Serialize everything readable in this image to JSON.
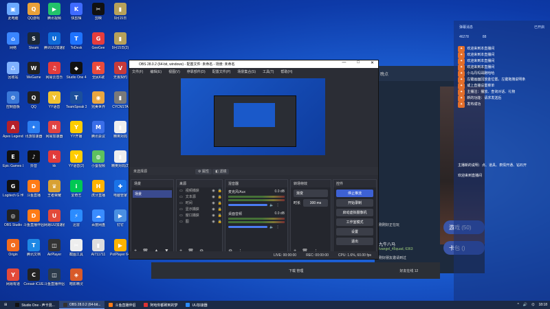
{
  "desktop_icons": [
    {
      "label": "此电脑",
      "color": "#6aa9ff",
      "glyph": "▣"
    },
    {
      "label": "QQ游戏",
      "color": "#e8a13a",
      "glyph": "Q"
    },
    {
      "label": "腾讯视频",
      "color": "#23c26b",
      "glyph": "▶"
    },
    {
      "label": "快剪辑",
      "color": "#3f6bff",
      "glyph": "K"
    },
    {
      "label": "剪映",
      "color": "#111111",
      "glyph": "✂"
    },
    {
      "label": "9月15日",
      "color": "#b7a15a",
      "glyph": "▮"
    },
    {
      "label": "网络",
      "color": "#3a86ff",
      "glyph": "⌂"
    },
    {
      "label": "Steam",
      "color": "#1b2838",
      "glyph": "S"
    },
    {
      "label": "腾讯UU加速器",
      "color": "#0f6bd9",
      "glyph": "U"
    },
    {
      "label": "ToDesk",
      "color": "#1e73ff",
      "glyph": "T"
    },
    {
      "label": "GeeGee",
      "color": "#e53d3d",
      "glyph": "G"
    },
    {
      "label": "9月15日(2)",
      "color": "#b7a15a",
      "glyph": "▮"
    },
    {
      "label": "回收站",
      "color": "#7fb1ff",
      "glyph": "♺"
    },
    {
      "label": "WeGame",
      "color": "#222222",
      "glyph": "W"
    },
    {
      "label": "网易云音乐",
      "color": "#e33c3c",
      "glyph": "♫"
    },
    {
      "label": "Studio One 4",
      "color": "#111111",
      "glyph": "◆"
    },
    {
      "label": "全民K歌",
      "color": "#e94b3c",
      "glyph": "K"
    },
    {
      "label": "无畏契约",
      "color": "#c63b3b",
      "glyph": "V"
    },
    {
      "label": "控制面板",
      "color": "#3a78d8",
      "glyph": "⚙"
    },
    {
      "label": "QQ",
      "color": "#222222",
      "glyph": "Q"
    },
    {
      "label": "YY语音",
      "color": "#f1c232",
      "glyph": "Y"
    },
    {
      "label": "TeamSpeak 3",
      "color": "#1c4f9c",
      "glyph": "T"
    },
    {
      "label": "完美世界",
      "color": "#e9a640",
      "glyph": "◉"
    },
    {
      "label": "CYCNSTA",
      "color": "#7a7a7a",
      "glyph": "▮"
    },
    {
      "label": "Apex Legends",
      "color": "#b4202a",
      "glyph": "A"
    },
    {
      "label": "讯游加速器",
      "color": "#2a7df1",
      "glyph": "✦"
    },
    {
      "label": "网易加速器",
      "color": "#e04343",
      "glyph": "N"
    },
    {
      "label": "YY开播",
      "color": "#ffcc00",
      "glyph": "Y"
    },
    {
      "label": "腾讯会议",
      "color": "#3a6ee8",
      "glyph": "M"
    },
    {
      "label": "精英对局",
      "color": "#eeeeee",
      "glyph": "▮"
    },
    {
      "label": "Epic Games Launcher",
      "color": "#111111",
      "glyph": "E"
    },
    {
      "label": "抖音",
      "color": "#111111",
      "glyph": "♪"
    },
    {
      "label": "kk",
      "color": "#e13b3b",
      "glyph": "k"
    },
    {
      "label": "YY语音(2)",
      "color": "#ffcc00",
      "glyph": "Y"
    },
    {
      "label": "小蚕视频",
      "color": "#5ec15e",
      "glyph": "◍"
    },
    {
      "label": "精英对局(2)",
      "color": "#eeeeee",
      "glyph": "▮"
    },
    {
      "label": "Logitech G HUB",
      "color": "#111111",
      "glyph": "G"
    },
    {
      "label": "斗鱼直播",
      "color": "#ff7b16",
      "glyph": "D"
    },
    {
      "label": "王者荣耀",
      "color": "#d8a133",
      "glyph": "♛"
    },
    {
      "label": "爱奇艺",
      "color": "#00c853",
      "glyph": "i"
    },
    {
      "label": "虎牙直播",
      "color": "#ffb300",
      "glyph": "H"
    },
    {
      "label": "电脑管家",
      "color": "#1a73e8",
      "glyph": "✚"
    },
    {
      "label": "OBS Studio",
      "color": "#222222",
      "glyph": "◎"
    },
    {
      "label": "斗鱼直播伴侣",
      "color": "#ff7b16",
      "glyph": "D"
    },
    {
      "label": "网易UU加速器",
      "color": "#e24a3a",
      "glyph": "U"
    },
    {
      "label": "迅雷",
      "color": "#2b8cff",
      "glyph": "⚡"
    },
    {
      "label": "百度网盘",
      "color": "#3a8cff",
      "glyph": "☁"
    },
    {
      "label": "钉钉",
      "color": "#4a90e2",
      "glyph": "▶"
    },
    {
      "label": "Origin",
      "color": "#f26b1d",
      "glyph": "O"
    },
    {
      "label": "腾讯文档",
      "color": "#1e88e5",
      "glyph": "T"
    },
    {
      "label": "AirPlayer",
      "color": "#333333",
      "glyph": "◫"
    },
    {
      "label": "截图工具",
      "color": "#eeeeee",
      "glyph": "✂"
    },
    {
      "label": "AI711711",
      "color": "#dddddd",
      "glyph": "▮"
    },
    {
      "label": "PotPlayer 64 bit",
      "color": "#ffb400",
      "glyph": "▶"
    },
    {
      "label": "网易有道",
      "color": "#e34a3a",
      "glyph": "Y"
    },
    {
      "label": "Corsair iCUE",
      "color": "#222222",
      "glyph": "C"
    },
    {
      "label": "斗鱼直播伴侣(2)",
      "color": "#2b3a4a",
      "glyph": "◫"
    },
    {
      "label": "暗影精灵",
      "color": "#d85a2a",
      "glyph": "◈"
    }
  ],
  "obs": {
    "title": "OBS 28.0.2 (64-bit, windows) - 配置文件: 未命名 - 场景: 未命名",
    "menu": [
      "文件(F)",
      "编辑(E)",
      "视图(V)",
      "停靠部件(D)",
      "配置文件(P)",
      "场景集合(S)",
      "工具(T)",
      "帮助(H)"
    ],
    "source_label": "未选择源",
    "props_btn": "属性",
    "filters_btn": "滤镜",
    "scenes_title": "场景",
    "scene_item": "场景",
    "sources_title": "来源",
    "sources": [
      "视频捕获",
      "文本源",
      "时间",
      "显示捕获",
      "窗口捕获",
      "图"
    ],
    "mixer_title": "混音器",
    "mixer": [
      {
        "name": "麦克风/Aux",
        "db": "0.0 dB"
      },
      {
        "name": "桌面音频",
        "db": "0.0 dB"
      }
    ],
    "transitions_title": "转场特效",
    "transition_value": "渐变",
    "duration_label": "时长",
    "duration_value": "300 ms",
    "controls_title": "控件",
    "controls": [
      "停止推流",
      "开始录制",
      "启动虚拟摄像机",
      "工作室模式",
      "设置",
      "退出"
    ],
    "status": {
      "live": "LIVE: 00:00:00",
      "rec": "REC: 00:00:00",
      "cpu": "CPU: 1.6%, 60.00 fps"
    }
  },
  "chat": {
    "header_left": "弹幕消息",
    "header_right": "已开启",
    "stats_a": "46278",
    "stats_b": "88",
    "lines": [
      {
        "tag": "",
        "who": "",
        "text": "欢迎来到本直播间"
      },
      {
        "tag": "",
        "who": "",
        "text": "欢迎来到本直播间"
      },
      {
        "tag": "",
        "who": "",
        "text": "欢迎来到本直播间"
      },
      {
        "tag": "",
        "who": "",
        "text": "欢迎来到本直播间"
      },
      {
        "tag": "",
        "who": "",
        "text": "小马丹玛哥跑哈哈"
      },
      {
        "tag": "",
        "who": "",
        "text": "左键画面回放金位置。左键拖拽说明条"
      },
      {
        "tag": "",
        "who": "",
        "text": "或上直播设置菜单"
      },
      {
        "tag": "",
        "who": "",
        "text": "主播注：播放、查询对话、礼物"
      },
      {
        "tag": "",
        "who": "",
        "text": "新的功能：请求发送后"
      },
      {
        "tag": "",
        "who": "",
        "text": "发布成功"
      }
    ],
    "gift_line": "欢迎来到直播间",
    "promo": "主播新的说明：点、道具、表情开通、钻石开"
  },
  "game": {
    "title": "晚点",
    "pill1": "游戏 (50)",
    "pill2": "卡包 ()",
    "notice": "刚刚好正在玩",
    "friend": "九牛八马",
    "friend_sub": "Ivangel_45quad, 6363",
    "invite": "刚好朋友邀请到过"
  },
  "launcher": {
    "center": "下载 管理",
    "right": "好友在线 12 "
  },
  "taskbar": {
    "items": [
      {
        "label": "Studio One - 声卡混...",
        "color": "#111111",
        "active": false
      },
      {
        "label": "OBS 28.0.2 (64-bit...",
        "color": "#333333",
        "active": true
      },
      {
        "label": "斗鱼直播伴侣",
        "color": "#ff7b16",
        "active": false
      },
      {
        "label": "阿哈你都刷到的梦",
        "color": "#d33",
        "active": false
      },
      {
        "label": "UU加速器",
        "color": "#2b8cff",
        "active": false
      }
    ],
    "clock": "18:18"
  }
}
